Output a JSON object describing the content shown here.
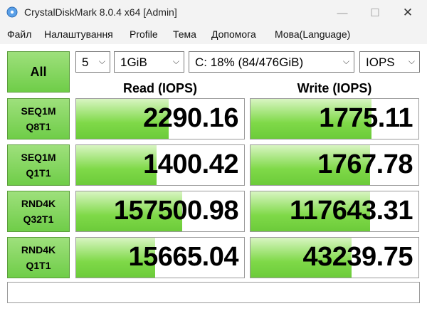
{
  "window": {
    "title": "CrystalDiskMark 8.0.4 x64 [Admin]"
  },
  "menu": [
    "Файл",
    "Налаштування",
    "Profile",
    "Тема",
    "Допомога",
    "Мова(Language)"
  ],
  "controls": {
    "all_label": "All",
    "count": "5",
    "size": "1GiB",
    "drive": "C: 18% (84/476GiB)",
    "unit": "IOPS"
  },
  "headers": {
    "read": "Read (IOPS)",
    "write": "Write (IOPS)"
  },
  "tests": [
    {
      "line1": "SEQ1M",
      "line2": "Q8T1",
      "read": "2290.16",
      "write": "1775.11",
      "read_fill": 0.55,
      "write_fill": 0.72
    },
    {
      "line1": "SEQ1M",
      "line2": "Q1T1",
      "read": "1400.42",
      "write": "1767.78",
      "read_fill": 0.48,
      "write_fill": 0.71
    },
    {
      "line1": "RND4K",
      "line2": "Q32T1",
      "read": "157500.98",
      "write": "117643.31",
      "read_fill": 0.63,
      "write_fill": 0.71
    },
    {
      "line1": "RND4K",
      "line2": "Q1T1",
      "read": "15665.04",
      "write": "43239.75",
      "read_fill": 0.47,
      "write_fill": 0.6
    }
  ],
  "status_text": "",
  "colors": {
    "accent_green": "#6fcd48",
    "bar_green": "#7fd948"
  }
}
